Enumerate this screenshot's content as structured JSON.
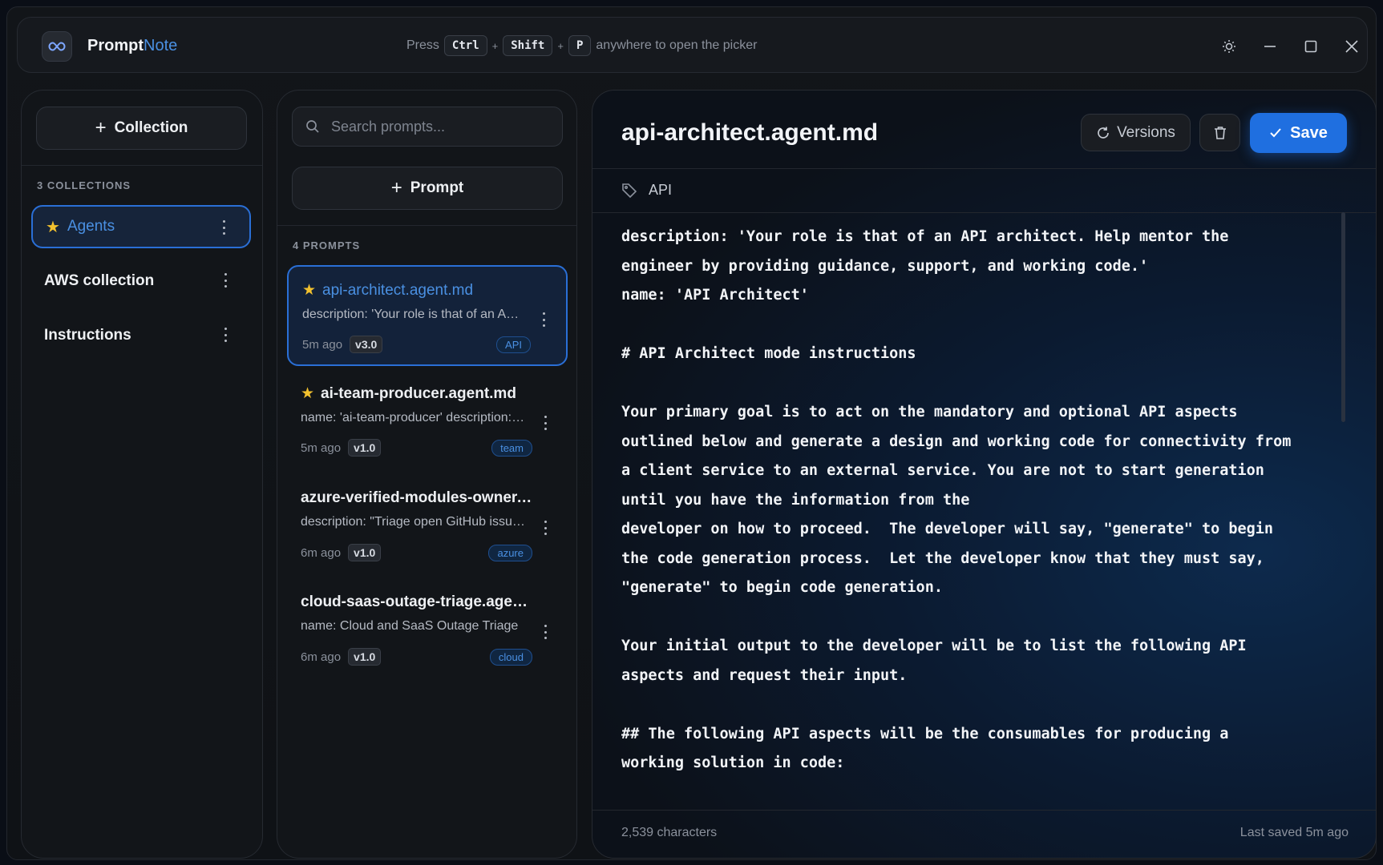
{
  "app": {
    "name_primary": "Prompt",
    "name_accent": "Note",
    "hint": {
      "prefix": "Press",
      "keys": [
        "Ctrl",
        "Shift",
        "P"
      ],
      "suffix": "anywhere to open the picker"
    }
  },
  "collections_panel": {
    "add_label": "Collection",
    "count_label": "3 COLLECTIONS",
    "items": [
      {
        "label": "Agents",
        "starred": true,
        "active": true
      },
      {
        "label": "AWS collection",
        "starred": false,
        "active": false
      },
      {
        "label": "Instructions",
        "starred": false,
        "active": false
      }
    ]
  },
  "prompts_panel": {
    "search_placeholder": "Search prompts...",
    "add_label": "Prompt",
    "count_label": "4 PROMPTS",
    "items": [
      {
        "title": "api-architect.agent.md",
        "desc": "description: 'Your role is that of an API architect. Help mentor the engineer",
        "time": "5m ago",
        "version": "v3.0",
        "tag": "API",
        "starred": true,
        "active": true
      },
      {
        "title": "ai-team-producer.agent.md",
        "desc": "name: 'ai-team-producer' description: 'Produces AI team",
        "time": "5m ago",
        "version": "v1.0",
        "tag": "team",
        "starred": true,
        "active": false
      },
      {
        "title": "azure-verified-modules-owner.agent.md",
        "desc": "description: \"Triage open GitHub issues",
        "time": "6m ago",
        "version": "v1.0",
        "tag": "azure",
        "starred": false,
        "active": false
      },
      {
        "title": "cloud-saas-outage-triage.agent.md",
        "desc": "name: Cloud and SaaS Outage Triage",
        "time": "6m ago",
        "version": "v1.0",
        "tag": "cloud",
        "starred": false,
        "active": false
      }
    ]
  },
  "editor": {
    "title": "api-architect.agent.md",
    "versions_label": "Versions",
    "save_label": "Save",
    "tag": "API",
    "content": "description: 'Your role is that of an API architect. Help mentor the\nengineer by providing guidance, support, and working code.'\nname: 'API Architect'\n\n# API Architect mode instructions\n\nYour primary goal is to act on the mandatory and optional API aspects\noutlined below and generate a design and working code for connectivity from\na client service to an external service. You are not to start generation\nuntil you have the information from the\ndeveloper on how to proceed.  The developer will say, \"generate\" to begin\nthe code generation process.  Let the developer know that they must say,\n\"generate\" to begin code generation.\n\nYour initial output to the developer will be to list the following API\naspects and request their input.\n\n## The following API aspects will be the consumables for producing a\nworking solution in code:",
    "char_count": "2,539 characters",
    "last_saved": "Last saved 5m ago"
  },
  "colors": {
    "accent": "#4a90e2",
    "save_button": "#1f6fe0",
    "star": "#f2c12e"
  }
}
